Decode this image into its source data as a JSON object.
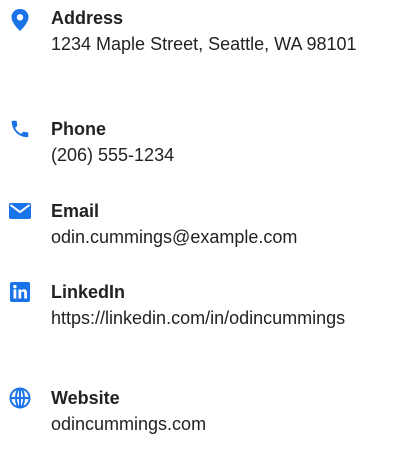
{
  "accent_color": "#1a73e8",
  "contacts": [
    {
      "icon": "map-pin-icon",
      "label": "Address",
      "value": "1234 Maple Street, Seattle, WA 98101"
    },
    {
      "icon": "phone-icon",
      "label": "Phone",
      "value": "(206) 555-1234"
    },
    {
      "icon": "envelope-icon",
      "label": "Email",
      "value": "odin.cummings@example.com"
    },
    {
      "icon": "linkedin-icon",
      "label": "LinkedIn",
      "value": "https://linkedin.com/in/odincummings"
    },
    {
      "icon": "globe-icon",
      "label": "Website",
      "value": "odincummings.com"
    }
  ]
}
